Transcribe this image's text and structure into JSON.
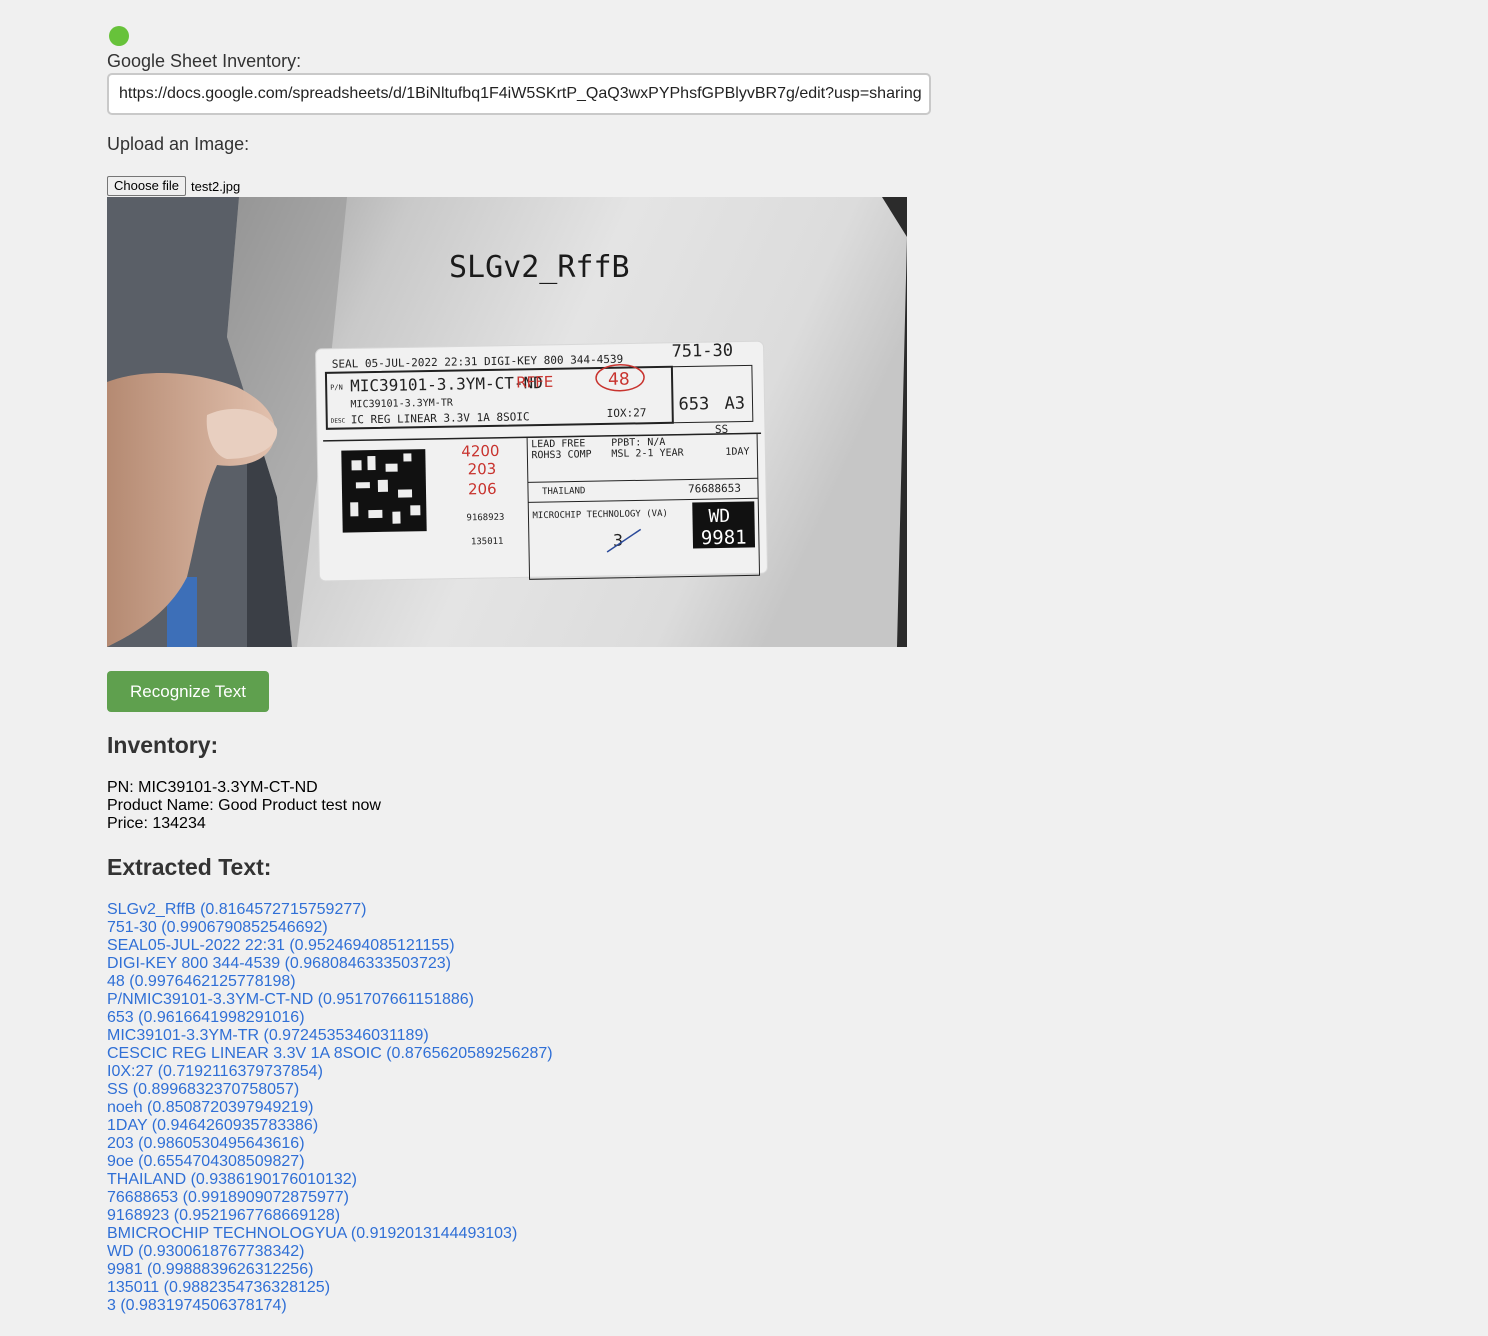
{
  "status": {
    "color": "#67c23a"
  },
  "sheet": {
    "label": "Google Sheet Inventory:",
    "url": "https://docs.google.com/spreadsheets/d/1BiNltufbq1F4iW5SKrtP_QaQ3wxPYPhsfGPBlyvBR7g/edit?usp=sharing"
  },
  "upload": {
    "label": "Upload an Image:",
    "button_label": "Choose file",
    "file_name": "test2.jpg"
  },
  "photo": {
    "handwriting_top": "SLGv2_RffB",
    "label": {
      "line1": "SEAL   05-JUL-2022 22:31   DIGI-KEY 800 344-4539",
      "code_top": "751-30",
      "pn_prefix": "P/N",
      "pn": "MIC39101-3.3YM-CT-ND",
      "hand_rffe": "RFFE",
      "hand_48": "48",
      "mfg": "MIC39101-3.3YM-TR",
      "desc_prefix": "DESC",
      "desc": "IC REG LINEAR 3.3V 1A 8SOIC",
      "iox": "IOX:27",
      "num653": "653",
      "a3": "A3",
      "ss": "SS",
      "hand_qty1": "4200",
      "hand_qty2": "203",
      "hand_qty3": "206",
      "lead_free": "LEAD FREE",
      "rohs": "ROHS3 COMP",
      "ppbt": "PPBT: N/A",
      "msl": "MSL 2-1 YEAR",
      "oneday": "1DAY",
      "country": "THAILAND",
      "code2": "76688653",
      "code3": "9168923",
      "mfr": "MICROCHIP TECHNOLOGY (VA)",
      "wd": "WD",
      "wd_num": "9981",
      "code4": "135011",
      "hand_3": "3"
    }
  },
  "recognize": {
    "label": "Recognize Text",
    "color": "#5fa04e"
  },
  "inventory": {
    "title": "Inventory:",
    "pn": "PN: MIC39101-3.3YM-CT-ND",
    "product_name": "Product Name: Good Product test now",
    "price": "Price: 134234"
  },
  "extracted": {
    "title": "Extracted Text:",
    "items": [
      "SLGv2_RffB (0.8164572715759277)",
      "751-30 (0.9906790852546692)",
      "SEAL05-JUL-2022 22:31 (0.9524694085121155)",
      "DIGI-KEY 800 344-4539 (0.9680846333503723)",
      "48 (0.9976462125778198)",
      "P/NMIC39101-3.3YM-CT-ND (0.951707661151886)",
      "653 (0.9616641998291016)",
      "MIC39101-3.3YM-TR (0.9724535346031189)",
      "CESCIC REG LINEAR 3.3V 1A 8SOIC (0.8765620589256287)",
      "I0X:27 (0.7192116379737854)",
      "SS (0.8996832370758057)",
      "noeh (0.8508720397949219)",
      "1DAY (0.9464260935783386)",
      "203 (0.9860530495643616)",
      "9oe (0.6554704308509827)",
      "THAILAND (0.9386190176010132)",
      "76688653 (0.9918909072875977)",
      "9168923 (0.9521967768669128)",
      "BMICROCHIP TECHNOLOGYUA (0.9192013144493103)",
      "WD (0.9300618767738342)",
      "9981 (0.9988839626312256)",
      "135011 (0.9882354736328125)",
      "3 (0.9831974506378174)"
    ]
  }
}
